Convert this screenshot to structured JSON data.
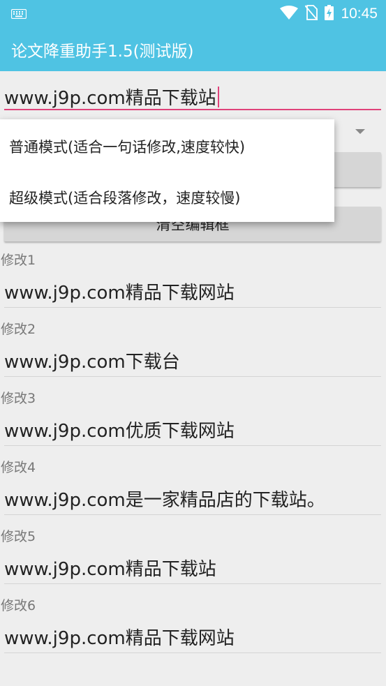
{
  "status_bar": {
    "time": "10:45"
  },
  "app_bar": {
    "title": "论文降重助手1.5(测试版)"
  },
  "input": {
    "value": "www.j9p.com精品下载站"
  },
  "buttons": {
    "clear_label": "清空编辑框"
  },
  "dropdown": {
    "options": [
      "普通模式(适合一句话修改,速度较快)",
      "超级模式(适合段落修改，速度较慢)"
    ]
  },
  "results": [
    {
      "label": "修改1",
      "value": "www.j9p.com精品下载网站"
    },
    {
      "label": "修改2",
      "value": "www.j9p.com下载台"
    },
    {
      "label": "修改3",
      "value": "www.j9p.com优质下载网站"
    },
    {
      "label": "修改4",
      "value": "www.j9p.com是一家精品店的下载站。"
    },
    {
      "label": "修改5",
      "value": "www.j9p.com精品下载站"
    },
    {
      "label": "修改6",
      "value": "www.j9p.com精品下载网站"
    }
  ],
  "colors": {
    "primary": "#4fc3e3",
    "accent": "#e0427a",
    "background": "#eeeeee"
  }
}
